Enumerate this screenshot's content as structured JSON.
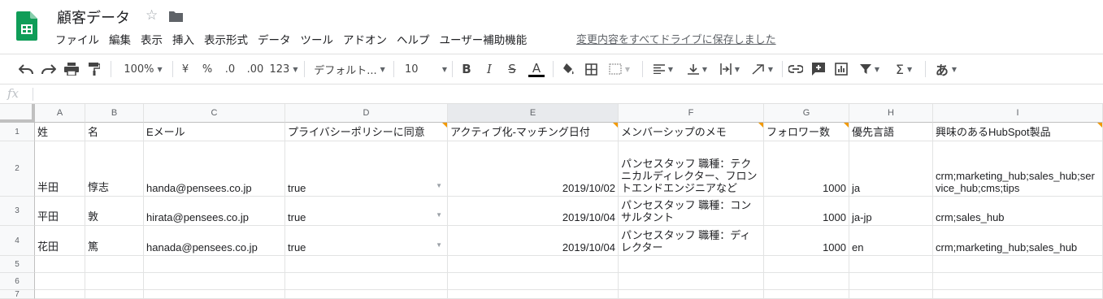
{
  "doc": {
    "title": "顧客データ"
  },
  "menu": [
    "ファイル",
    "編集",
    "表示",
    "挿入",
    "表示形式",
    "データ",
    "ツール",
    "アドオン",
    "ヘルプ",
    "ユーザー補助機能"
  ],
  "save_status": "変更内容をすべてドライブに保存しました",
  "toolbar": {
    "zoom": "100%",
    "currency": "¥",
    "percent": "%",
    "dec_decrease": ".0",
    "dec_increase": ".00",
    "more_formats": "123",
    "font": "デフォルト...",
    "font_size": "10",
    "bold": "B",
    "italic": "I",
    "strike": "S",
    "text_color": "A",
    "input_tool": "あ"
  },
  "formula_bar": {
    "fx": "fx",
    "value": ""
  },
  "columns": [
    "A",
    "B",
    "C",
    "D",
    "E",
    "F",
    "G",
    "H",
    "I"
  ],
  "row_numbers": [
    "1",
    "2",
    "3",
    "4",
    "5",
    "6",
    "7"
  ],
  "rows": [
    [
      "姓",
      "名",
      "Eメール",
      "プライバシーポリシーに同意",
      "アクティブ化-マッチング日付",
      "メンバーシップのメモ",
      "フォロワー数",
      "優先言語",
      "興味のあるHubSpot製品"
    ],
    [
      "半田",
      "惇志",
      "handa@pensees.co.jp",
      "true",
      "2019/10/02",
      "パンセスタッフ 職種：テクニカルディレクター、フロントエンドエンジニアなど",
      "1000",
      "ja",
      "crm;marketing_hub;sales_hub;service_hub;cms;tips"
    ],
    [
      "平田",
      "敦",
      "hirata@pensees.co.jp",
      "true",
      "2019/10/04",
      "パンセスタッフ 職種：コンサルタント",
      "1000",
      "ja-jp",
      "crm;sales_hub"
    ],
    [
      "花田",
      "篤",
      "hanada@pensees.co.jp",
      "true",
      "2019/10/04",
      "パンセスタッフ 職種：ディレクター",
      "1000",
      "en",
      "crm;marketing_hub;sales_hub"
    ]
  ],
  "colors": {
    "sheets_green": "#0f9d58",
    "note_orange": "#f29900"
  }
}
